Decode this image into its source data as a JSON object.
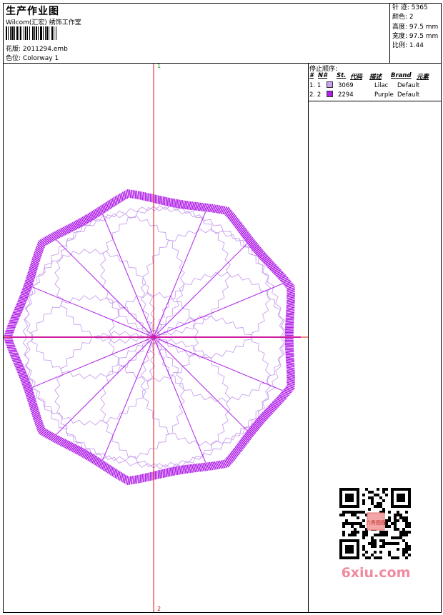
{
  "header": {
    "title": "生产作业图",
    "company": "Wilcom(汇宏) 绣饰工作室",
    "file_label": "花版:",
    "file_name": "2011294.emb",
    "colorway_label": "色位:",
    "colorway_name": "Colorway 1"
  },
  "specs": {
    "stitches": "针 迹:  5365",
    "colors": "颜色:  2",
    "height": "高度:  97.5 mm",
    "width": "宽度:  97.5 mm",
    "scale": "比例:  1.44"
  },
  "sequence": {
    "title": "停止顺序:",
    "headers": [
      "#",
      "N#",
      "St.",
      "代码",
      "描述",
      "Brand",
      "元素"
    ],
    "rows": [
      {
        "idx": "1.",
        "num": "1",
        "code": "3069",
        "desc": "Lilac",
        "brand": "Default",
        "color": "#c9a0ee"
      },
      {
        "idx": "2.",
        "num": "2",
        "code": "2294",
        "desc": "Purple",
        "brand": "Default",
        "color": "#b01fe8"
      }
    ]
  },
  "axis": {
    "top_label": "1",
    "bottom_label": "2"
  },
  "watermark": {
    "text": "6xiu.com",
    "qr_badge": "六秀图图"
  }
}
